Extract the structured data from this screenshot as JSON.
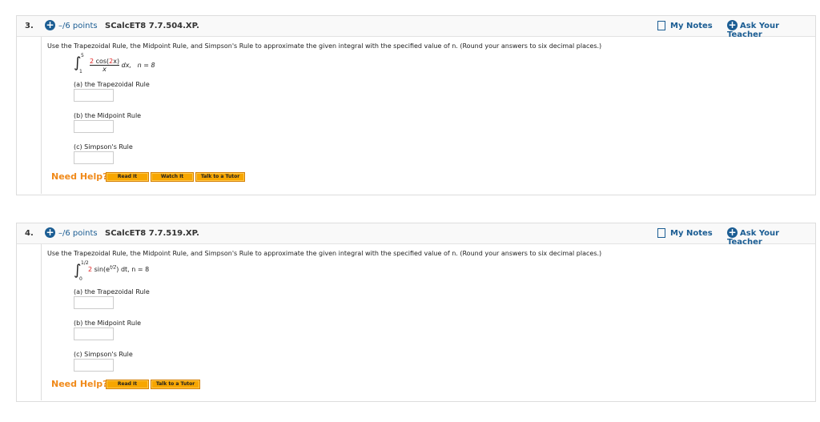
{
  "questions": [
    {
      "number": "3.",
      "points": "–/6 points",
      "code": "SCalcET8 7.7.504.XP.",
      "my_notes": "My Notes",
      "ask_teacher": "Ask Your Teacher",
      "prompt": "Use the Trapezoidal Rule, the Midpoint Rule, and Simpson's Rule to approximate the given integral with the specified value of n. (Round your answers to six decimal places.)",
      "integral": {
        "upper": "5",
        "lower": "1",
        "numerator_coef": "2",
        "numerator_mid": " cos(",
        "numerator_arg": "2",
        "numerator_end": "x)",
        "denominator": "x",
        "differential": "dx,",
        "n": "n = 8"
      },
      "parts": [
        "(a) the Trapezoidal Rule",
        "(b) the Midpoint Rule",
        "(c) Simpson's Rule"
      ],
      "need_help": "Need Help?",
      "buttons": [
        "Read It",
        "Watch It",
        "Talk to a Tutor"
      ]
    },
    {
      "number": "4.",
      "points": "–/6 points",
      "code": "SCalcET8 7.7.519.XP.",
      "my_notes": "My Notes",
      "ask_teacher": "Ask Your Teacher",
      "prompt": "Use the Trapezoidal Rule, the Midpoint Rule, and Simpson's Rule to approximate the given integral with the specified value of n. (Round your answers to six decimal places.)",
      "integral": {
        "upper": "1/2",
        "lower": "0",
        "coef": "2",
        "body": " sin(e",
        "exp": "t/2",
        "close": ") dt, n = 8"
      },
      "parts": [
        "(a) the Trapezoidal Rule",
        "(b) the Midpoint Rule",
        "(c) Simpson's Rule"
      ],
      "need_help": "Need Help?",
      "buttons": [
        "Read It",
        "Talk to a Tutor"
      ]
    }
  ]
}
